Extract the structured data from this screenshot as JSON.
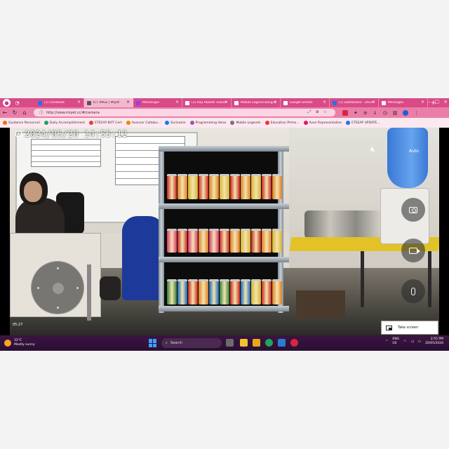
{
  "browser": {
    "tabs": [
      {
        "title": "(1) Facebook",
        "color": "#1877f2",
        "active": false
      },
      {
        "title": "ICT PAGE | Miyet",
        "color": "#555555",
        "active": true
      },
      {
        "title": "Messenger",
        "color": "#8a3ffc",
        "active": false
      },
      {
        "title": "(1) Ray Abalde Tuazon",
        "color": "#ffffff",
        "active": false
      },
      {
        "title": "Mobile Legend Bang Bang",
        "color": "#ffffff",
        "active": false
      },
      {
        "title": "Google Sheets",
        "color": "#ffffff",
        "active": false
      },
      {
        "title": "(1) Dashboard - ZACH",
        "color": "#1877f2",
        "active": false
      },
      {
        "title": "Messages",
        "color": "#ffffff",
        "active": false
      }
    ],
    "address": "http://view.miyet.cc/#/camera",
    "bookmarks": [
      {
        "label": "Guidance Personnel",
        "color": "#ff6a00"
      },
      {
        "label": "Daily Accomplishment",
        "color": "#1da462"
      },
      {
        "label": "ETEEAP BOT Cert",
        "color": "#d9453d"
      },
      {
        "label": "Avancer Caltabu...",
        "color": "#e68a00"
      },
      {
        "label": "Suriname",
        "color": "#1877f2"
      },
      {
        "label": "Programming Ideas",
        "color": "#9b59b6"
      },
      {
        "label": "Mobile Legends",
        "color": "#777777"
      },
      {
        "label": "Education Prime...",
        "color": "#e53935"
      },
      {
        "label": "Avon Representative",
        "color": "#d81b60"
      },
      {
        "label": "ETEEAP UPDATE...",
        "color": "#1877f2"
      }
    ]
  },
  "camera": {
    "timestamp": "2024/05/20  14:55:12",
    "elapsed": "05:27",
    "auto_label": "Auto",
    "pip_label": "Take screen",
    "icons": {
      "mute": "speaker-muted-icon",
      "snapshot": "camera-icon",
      "record": "video-record-icon",
      "mic": "microphone-icon",
      "back": "chevron-left-icon"
    }
  },
  "taskbar": {
    "weather_temp": "31°C",
    "weather_desc": "Mostly sunny",
    "search_placeholder": "Search",
    "language": "ENG",
    "region": "US",
    "time": "2:55 PM",
    "date": "20/05/2024"
  },
  "colors": {
    "tab_strip": "#d94a86",
    "address_bar": "#e97ea9",
    "taskbar": "#2a0f33",
    "page_background": "#f3f3f3"
  }
}
